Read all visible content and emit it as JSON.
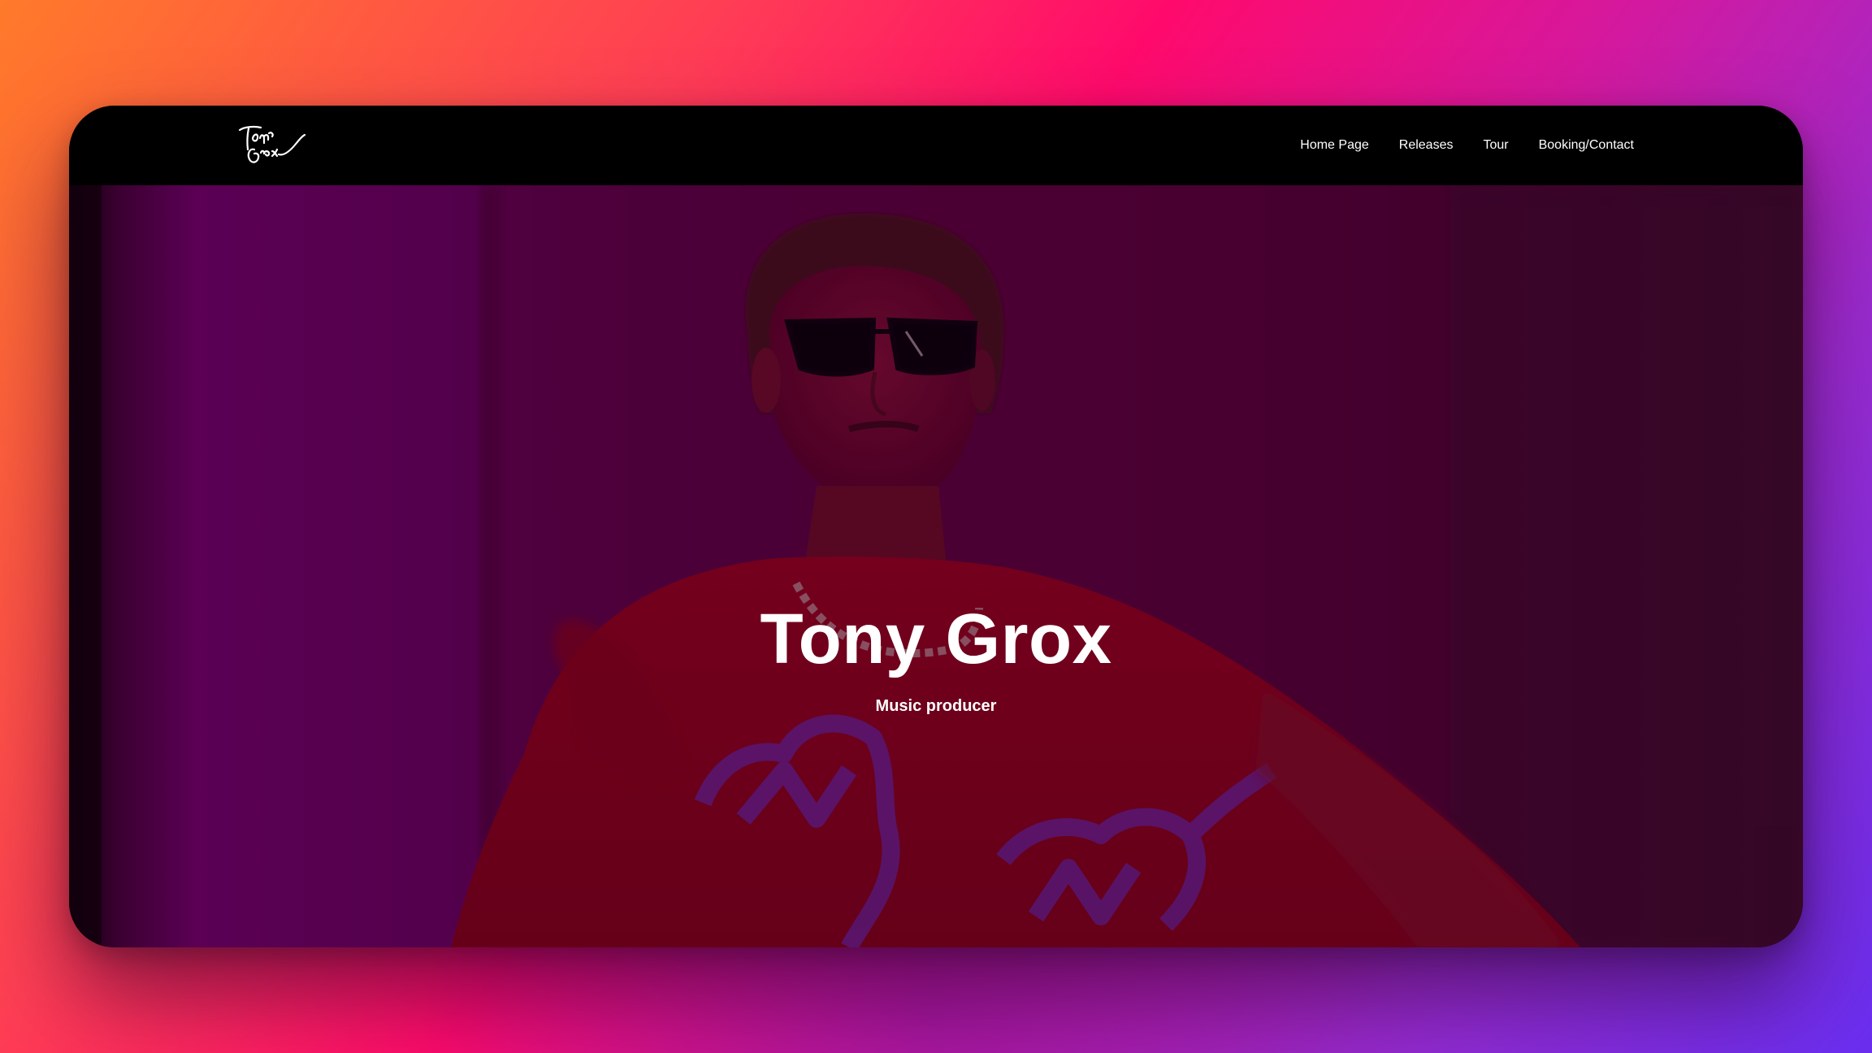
{
  "site": {
    "logo_text": "Tony Grox",
    "logo_icon": "signature-logo-icon"
  },
  "nav": {
    "items": [
      {
        "label": "Home Page"
      },
      {
        "label": "Releases"
      },
      {
        "label": "Tour"
      },
      {
        "label": "Booking/Contact"
      }
    ]
  },
  "hero": {
    "title": "Tony Grox",
    "subtitle": "Music producer",
    "image": "artist-portrait-image"
  },
  "colors": {
    "background_gradient": [
      "#ff7a2a",
      "#ff0a6c",
      "#6a2ef0"
    ],
    "navbar": "#000000",
    "hero_overlay": "#5a0050",
    "text": "#ffffff"
  }
}
